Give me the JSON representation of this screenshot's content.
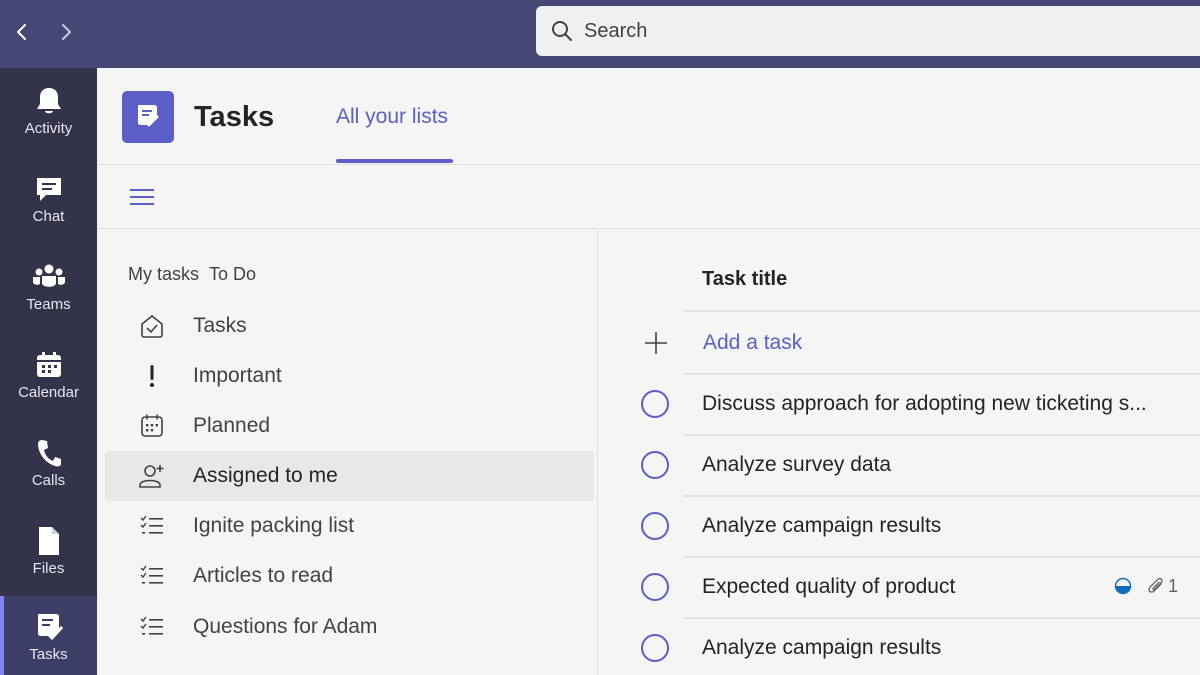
{
  "search": {
    "placeholder": "Search"
  },
  "rail": {
    "items": [
      {
        "label": "Activity",
        "icon": "bell-icon"
      },
      {
        "label": "Chat",
        "icon": "chat-icon"
      },
      {
        "label": "Teams",
        "icon": "teams-icon"
      },
      {
        "label": "Calendar",
        "icon": "calendar-icon"
      },
      {
        "label": "Calls",
        "icon": "phone-icon"
      },
      {
        "label": "Files",
        "icon": "file-icon"
      },
      {
        "label": "Tasks",
        "icon": "tasks-icon",
        "active": true
      }
    ]
  },
  "header": {
    "app_title": "Tasks",
    "tab_label": "All your lists"
  },
  "lists": {
    "section_title": "My tasks",
    "section_subtitle": "To Do",
    "items": [
      {
        "label": "Tasks",
        "icon": "home-check-icon"
      },
      {
        "label": "Important",
        "icon": "exclamation-icon"
      },
      {
        "label": "Planned",
        "icon": "calendar-grid-icon"
      },
      {
        "label": "Assigned to me",
        "icon": "person-add-icon",
        "selected": true
      },
      {
        "label": "Ignite packing list",
        "icon": "checklist-icon"
      },
      {
        "label": "Articles to read",
        "icon": "checklist-icon"
      },
      {
        "label": "Questions for Adam",
        "icon": "checklist-icon"
      }
    ]
  },
  "tasks": {
    "column_header": "Task title",
    "add_label": "Add a task",
    "rows": [
      {
        "title": "Discuss approach for adopting new ticketing s..."
      },
      {
        "title": "Analyze survey data"
      },
      {
        "title": "Analyze campaign results"
      },
      {
        "title": "Expected quality of product",
        "attachments": "1"
      },
      {
        "title": "Analyze campaign results"
      }
    ]
  },
  "colors": {
    "titlebar": "#464775",
    "rail": "#33344a",
    "accent": "#5b5fc7",
    "background": "#f5f5f5"
  }
}
